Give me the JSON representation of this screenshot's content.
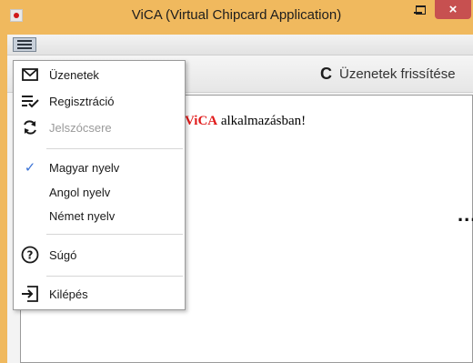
{
  "window": {
    "title": "ViCA (Virtual Chipcard Application)",
    "minimize_label": "",
    "maximize_label": "",
    "close_label": "×"
  },
  "toolbar": {
    "refresh_label": "Üzenetek frissítése",
    "refresh_icon": "C"
  },
  "main": {
    "welcome_prefix": "",
    "brand": "ViCA",
    "welcome_suffix": " alkalmazásban!",
    "more_label": "..."
  },
  "menu": {
    "items": [
      {
        "label": "Üzenetek",
        "icon": "mail-icon",
        "enabled": true
      },
      {
        "label": "Regisztráció",
        "icon": "register-icon",
        "enabled": true
      },
      {
        "label": "Jelszócsere",
        "icon": "change-password-icon",
        "enabled": false
      },
      {
        "label": "Magyar nyelv",
        "icon": "check-icon",
        "checked": true
      },
      {
        "label": "Angol nyelv",
        "icon": "",
        "checked": false
      },
      {
        "label": "Német nyelv",
        "icon": "",
        "checked": false
      },
      {
        "label": "Súgó",
        "icon": "help-icon",
        "enabled": true
      },
      {
        "label": "Kilépés",
        "icon": "exit-icon",
        "enabled": true
      }
    ]
  },
  "colors": {
    "frame": "#f0b95e",
    "close_button": "#c75050",
    "brand_red": "#e11b1b",
    "check_blue": "#3b73d6"
  }
}
